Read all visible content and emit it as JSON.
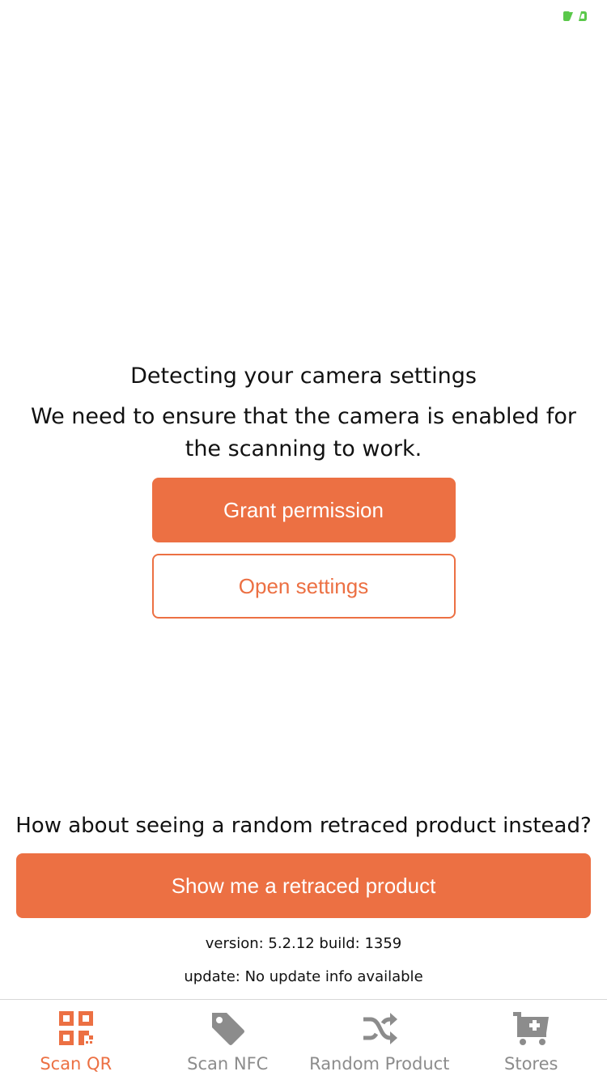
{
  "colors": {
    "accent": "#ec7043",
    "tab_inactive": "#8c8c8c",
    "battery_indicator": "#5ac84a"
  },
  "permission": {
    "title": "Detecting your camera settings",
    "description": "We need to ensure that the camera is enabled for the scanning to work.",
    "grant_label": "Grant permission",
    "settings_label": "Open settings"
  },
  "random": {
    "question": "How about seeing a random retraced product instead?",
    "button_label": "Show me a retraced product"
  },
  "footer": {
    "version": "version: 5.2.12 build: 1359",
    "update": "update: No update info available"
  },
  "tabs": [
    {
      "label": "Scan QR",
      "icon": "qr-code-icon",
      "active": true
    },
    {
      "label": "Scan NFC",
      "icon": "tag-icon",
      "active": false
    },
    {
      "label": "Random Product",
      "icon": "shuffle-icon",
      "active": false
    },
    {
      "label": "Stores",
      "icon": "cart-plus-icon",
      "active": false
    }
  ]
}
